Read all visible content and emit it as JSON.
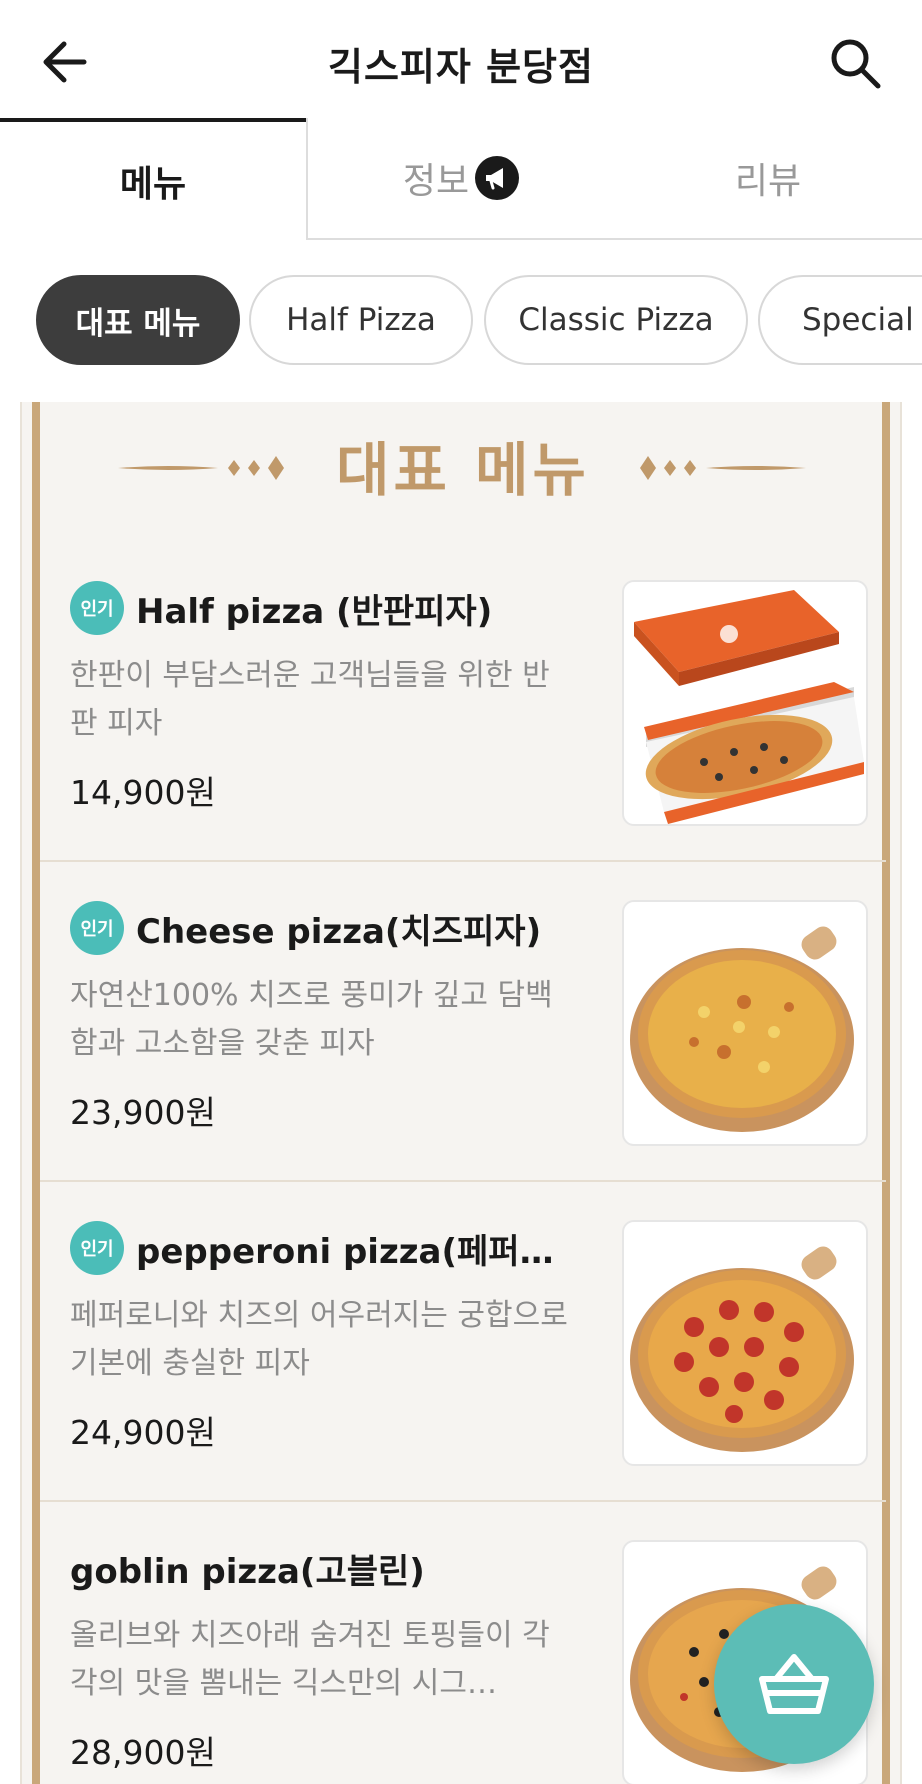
{
  "header": {
    "store_name": "긱스피자 분당점",
    "back_icon": "arrow-left-icon",
    "search_icon": "search-icon"
  },
  "tabs": [
    {
      "label": "메뉴",
      "active": true
    },
    {
      "label": "정보",
      "icon": "megaphone-icon",
      "active": false
    },
    {
      "label": "리뷰",
      "active": false
    }
  ],
  "categories": [
    {
      "label": "대표 메뉴",
      "active": true
    },
    {
      "label": "Half Pizza",
      "active": false
    },
    {
      "label": "Classic Pizza",
      "active": false
    },
    {
      "label": "Special p",
      "active": false
    }
  ],
  "featured": {
    "title": "대표 메뉴",
    "items": [
      {
        "badge": "인기",
        "name": "Half pizza (반판피자)",
        "description": "한판이 부담스러운 고객님들을 위한 반판 피자",
        "price": "14,900원",
        "image": "half-pizza-box"
      },
      {
        "badge": "인기",
        "name": "Cheese pizza(치즈피자)",
        "description": "자연산100% 치즈로 풍미가 깊고 담백함과 고소함을 갖춘 피자",
        "price": "23,900원",
        "image": "cheese-pizza"
      },
      {
        "badge": "인기",
        "name": "pepperoni pizza(페퍼로…",
        "description": "페퍼로니와 치즈의 어우러지는 궁합으로 기본에 충실한 피자",
        "price": "24,900원",
        "image": "pepperoni-pizza"
      },
      {
        "badge": "",
        "name": "goblin pizza(고블린)",
        "description": "올리브와 치즈아래 숨겨진 토핑들이 각각의 맛을 뽐내는 긱스만의 시그…",
        "price": "28,900원",
        "image": "goblin-pizza"
      }
    ]
  },
  "cart": {
    "icon": "basket-icon"
  },
  "colors": {
    "accent_teal": "#5cbdb6",
    "gold": "#c0996a",
    "chip_active": "#3d3d3d"
  }
}
